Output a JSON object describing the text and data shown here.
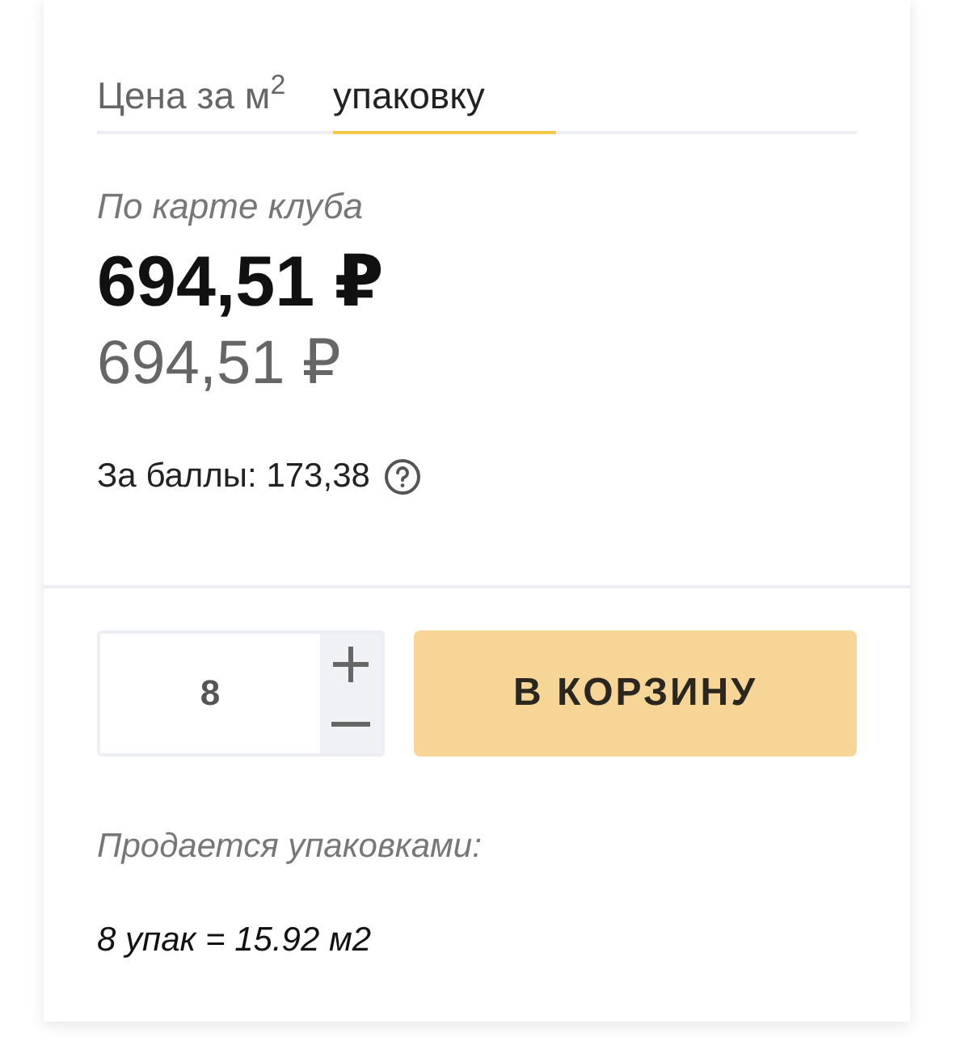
{
  "price_tabs": [
    {
      "label": "Цена за м$^{2}$",
      "selected": false
    },
    {
      "label": "упаковку",
      "selected": true
    }
  ],
  "club_label": "По карте клуба",
  "club_price": "694,51 ₽",
  "regular_price": "694,51 ₽",
  "points": {
    "text": "За баллы: 173,38"
  },
  "quantity": {
    "value": "8"
  },
  "cart_button": "В КОРЗИНУ",
  "sold_by": "Продается упаковками:",
  "pack_info": "8 упак = 15.92 м2"
}
